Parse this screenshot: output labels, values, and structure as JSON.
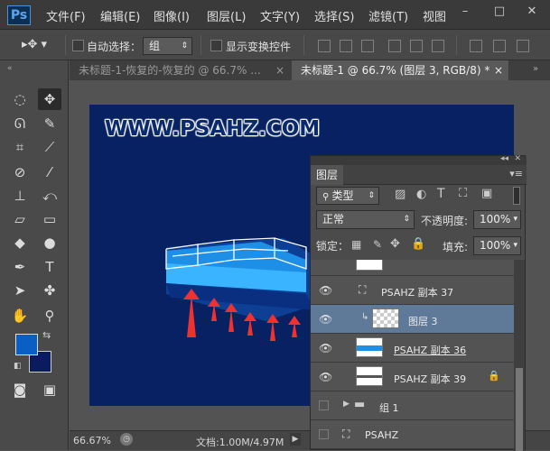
{
  "menubar": {
    "logo": "Ps",
    "items": [
      "文件(F)",
      "编辑(E)",
      "图像(I)",
      "图层(L)",
      "文字(Y)",
      "选择(S)",
      "滤镜(T)",
      "视图"
    ],
    "controls": [
      "–",
      "□",
      "✕"
    ]
  },
  "options": {
    "auto_select_label": "自动选择：",
    "auto_select_value": "组",
    "show_transform_label": "显示变换控件"
  },
  "tabs": [
    {
      "label": "未标题-1-恢复的-恢复的 @ 66.7% ...",
      "close": "×"
    },
    {
      "label": "未标题-1 @ 66.7% (图层 3, RGB/8) *",
      "close": "×"
    }
  ],
  "canvas": {
    "watermark": "WWW.PSAHZ.COM"
  },
  "status": {
    "zoom": "66.67%",
    "doc": "文档:1.00M/4.97M"
  },
  "layers_panel": {
    "title": "图层",
    "filter_label": "类型",
    "blend_mode": "正常",
    "opacity_label": "不透明度:",
    "opacity_value": "100%",
    "lock_label": "锁定：",
    "fill_label": "填充:",
    "fill_value": "100%",
    "layers": [
      {
        "name": "PSAHZ 副本 37",
        "type": "smart",
        "visible": true
      },
      {
        "name": "图层 3",
        "type": "layer",
        "visible": true,
        "selected": true
      },
      {
        "name": "PSAHZ 副本 36",
        "type": "smart",
        "visible": true
      },
      {
        "name": "PSAHZ 副本 39",
        "type": "layer",
        "visible": true,
        "locked": true
      },
      {
        "name": "组 1",
        "type": "group",
        "visible": false
      },
      {
        "name": "PSAHZ",
        "type": "smart",
        "visible": false
      }
    ]
  },
  "colors": {
    "foreground": "#0a5fc4",
    "background": "#0a1b5e",
    "canvas": "#072162"
  }
}
